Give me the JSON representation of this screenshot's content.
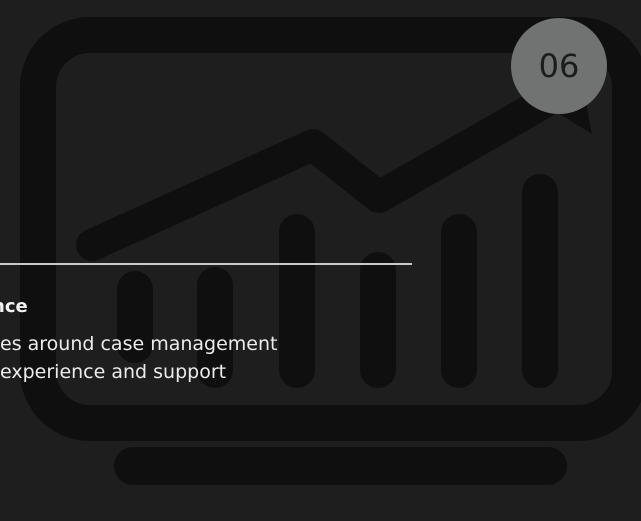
{
  "slide": {
    "number": "06",
    "title": "nce",
    "description_lines": [
      "es around case management",
      " experience and support"
    ]
  },
  "illustration": {
    "icon": "monitor-chart-icon"
  },
  "colors": {
    "background": "#1e1e1e",
    "illustration": "#0f0f0f",
    "badge": "#717272",
    "divider": "#c9c9c9",
    "text": "#ececec"
  }
}
